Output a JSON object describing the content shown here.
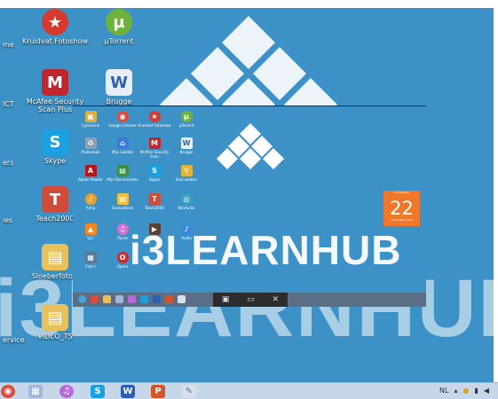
{
  "desktop": {
    "icons": [
      {
        "label": "Kruidvat Fotoshow",
        "icon": "kruidvat-icon",
        "color": "#d63a2f"
      },
      {
        "label": "µTorrent",
        "icon": "utorrent-icon",
        "color": "#6fb23b"
      },
      {
        "label": "McAfee Security Scan Plus",
        "icon": "mcafee-icon",
        "color": "#c0262c"
      },
      {
        "label": "Brugge",
        "icon": "word-doc-icon",
        "color": "#e8eef7"
      },
      {
        "label": "Skype",
        "icon": "skype-icon",
        "color": "#1aa0e0"
      },
      {
        "label": "Teach2000",
        "icon": "teach-icon",
        "color": "#d14b3a"
      },
      {
        "label": "Sloeberfoto's",
        "icon": "folder-icon",
        "color": "#e8c15a"
      },
      {
        "label": "VIDEO_TS",
        "icon": "folder-icon",
        "color": "#e8c15a"
      }
    ],
    "edge_labels": [
      "me",
      "ICT",
      "ers",
      "ies",
      "ervice"
    ]
  },
  "watermark": {
    "text_large": "i3LEARNHUB",
    "text_small": "i3LEARNHUB"
  },
  "calendar_tile": {
    "day": "22",
    "weekday": "donderdag",
    "month": "november 2018"
  },
  "inner_window": {
    "icons": [
      {
        "label": "CyberLink",
        "color": "#d8b040"
      },
      {
        "label": "Google Chrome",
        "color": "#e04a3a"
      },
      {
        "label": "Kruidvat Fotoshow",
        "color": "#d63a2f"
      },
      {
        "label": "µTorrent",
        "color": "#6fb23b"
      },
      {
        "label": "Prullenbak",
        "color": "#8ea0b8"
      },
      {
        "label": "Mijn Lokatie",
        "color": "#3a7bd5"
      },
      {
        "label": "McAfee Security Scan",
        "color": "#c0262c"
      },
      {
        "label": "Brugge",
        "color": "#e8eef7"
      },
      {
        "label": "Adobe Reader",
        "color": "#b3151b"
      },
      {
        "label": "Mijn Documenten",
        "color": "#3b8f4a"
      },
      {
        "label": "Skype",
        "color": "#1aa0e0"
      },
      {
        "label": "Snel zoeken",
        "color": "#e0b43a"
      },
      {
        "label": "Aimp",
        "color": "#e8a030"
      },
      {
        "label": "GroepsBoek",
        "color": "#f0c040"
      },
      {
        "label": "Teach2000",
        "color": "#d14b3a"
      },
      {
        "label": "WinAudio",
        "color": "#3aa0c0"
      },
      {
        "label": "VLC",
        "color": "#f08a20"
      },
      {
        "label": "iTunes",
        "color": "#d070d0"
      },
      {
        "label": "Video",
        "color": "#5a4030"
      },
      {
        "label": "Audio",
        "color": "#3a8ad8"
      },
      {
        "label": "Foto's",
        "color": "#5a7a9a"
      },
      {
        "label": "Opera",
        "color": "#d0282a"
      }
    ]
  },
  "taskbar": {
    "apps": [
      {
        "icon": "chrome-icon",
        "color": "#e04a3a"
      },
      {
        "icon": "explorer-icon",
        "color": "#9fb8d8"
      },
      {
        "icon": "itunes-icon",
        "color": "#b86ad8"
      },
      {
        "icon": "skype-icon",
        "color": "#1aa0e0"
      },
      {
        "icon": "word-icon",
        "color": "#2b5fb0"
      },
      {
        "icon": "powerpoint-icon",
        "color": "#d4542a"
      },
      {
        "icon": "paint-icon",
        "color": "#d7dfe8"
      }
    ],
    "tray_lang": "NL"
  }
}
